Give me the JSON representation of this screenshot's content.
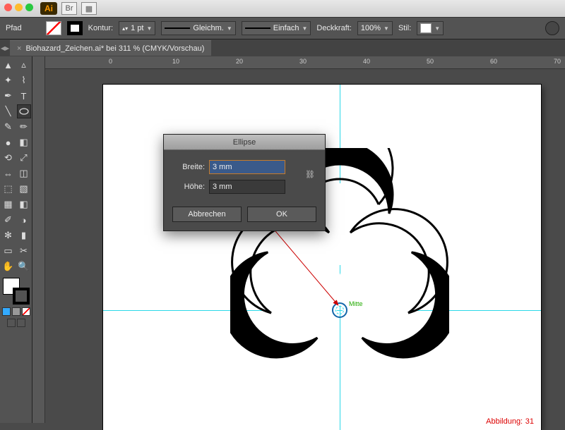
{
  "menubar": {
    "br": "Br"
  },
  "control": {
    "path_label": "Pfad",
    "kontur_label": "Kontur:",
    "stroke_weight": "1 pt",
    "cap_label": "Gleichm.",
    "limit_label": "Einfach",
    "opacity_label": "Deckkraft:",
    "opacity_value": "100%",
    "style_label": "Stil:"
  },
  "doc": {
    "tab_title": "Biohazard_Zeichen.ai* bei 311 % (CMYK/Vorschau)"
  },
  "ruler": {
    "m0": "0",
    "m10": "10",
    "m20": "20",
    "m30": "30",
    "m40": "40",
    "m50": "50",
    "m60": "60",
    "m70": "70"
  },
  "dialog": {
    "title": "Ellipse",
    "width_label": "Breite:",
    "width_value": "3 mm",
    "height_label": "Höhe:",
    "height_value": "3 mm",
    "cancel": "Abbrechen",
    "ok": "OK"
  },
  "smart_guide": "Mitte",
  "caption_label": "Abbildung:",
  "caption_num": "31"
}
